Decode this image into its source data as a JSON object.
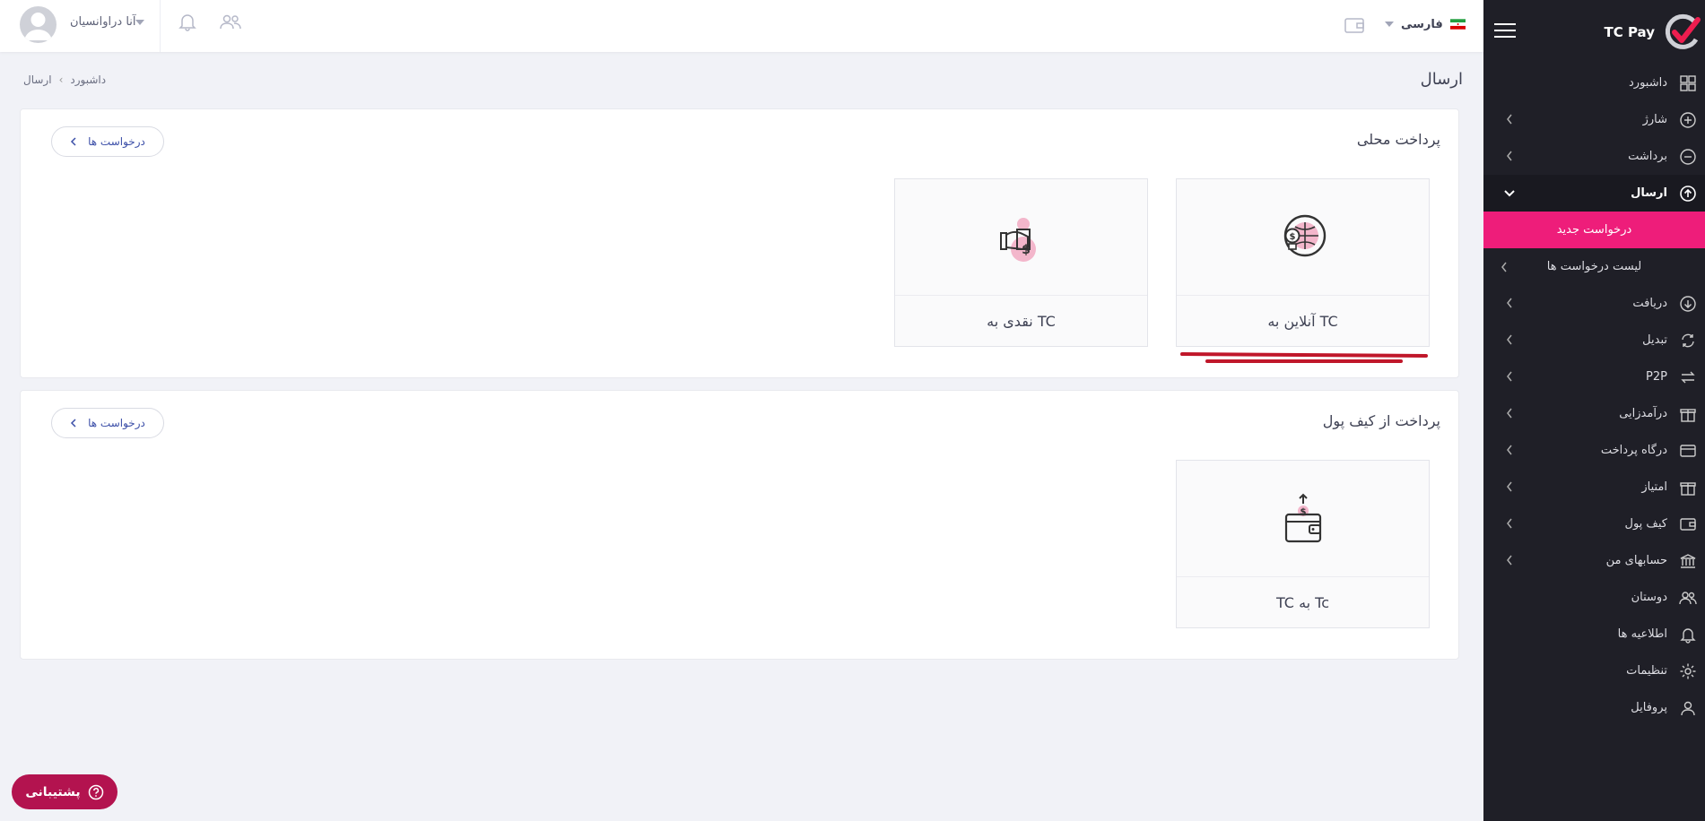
{
  "app": {
    "brand": "TC Pay"
  },
  "header": {
    "user_name": "آنا دراوانسیان",
    "language": "فارسی"
  },
  "page": {
    "title": "ارسال",
    "breadcrumb": [
      "داشبورد",
      "ارسال"
    ]
  },
  "sidebar": {
    "items": [
      {
        "label": "داشبورد",
        "icon": "dashboard-icon"
      },
      {
        "label": "شارژ",
        "icon": "plus-circle-icon"
      },
      {
        "label": "برداشت",
        "icon": "minus-circle-icon"
      },
      {
        "label": "ارسال",
        "icon": "upload-circle-icon"
      },
      {
        "label": "دریافت",
        "icon": "download-circle-icon"
      },
      {
        "label": "تبدیل",
        "icon": "exchange-icon"
      },
      {
        "label": "P2P",
        "icon": "transfer-icon"
      },
      {
        "label": "درآمدزایی",
        "icon": "gift-icon"
      },
      {
        "label": "درگاه پرداخت",
        "icon": "card-icon"
      },
      {
        "label": "امتیاز",
        "icon": "gift-icon"
      },
      {
        "label": "کیف پول",
        "icon": "wallet-icon"
      },
      {
        "label": "حسابهای من",
        "icon": "bank-icon"
      },
      {
        "label": "دوستان",
        "icon": "users-icon"
      },
      {
        "label": "اطلاعیه ها",
        "icon": "bell-icon"
      },
      {
        "label": "تنظیمات",
        "icon": "gear-icon"
      },
      {
        "label": "پروفایل",
        "icon": "user-icon"
      }
    ],
    "submenu": [
      {
        "label": "درخواست جدید"
      },
      {
        "label": "لیست درخواست ها"
      }
    ]
  },
  "sections": [
    {
      "title": "پرداخت محلی",
      "requests_label": "درخواست ها",
      "tiles": [
        {
          "label": "آنلاین به TC",
          "icon": "globe-dollar-icon"
        },
        {
          "label": "نقدی به TC",
          "icon": "cash-hand-icon"
        }
      ]
    },
    {
      "title": "پرداخت از کیف پول",
      "requests_label": "درخواست ها",
      "tiles": [
        {
          "label": "TC به Tc",
          "icon": "wallet-upload-icon"
        }
      ]
    }
  ],
  "support": {
    "label": "پشتیبانی"
  },
  "colors": {
    "sidebar_bg": "#1f1f27",
    "accent": "#ee1d7a",
    "support_bg": "#b3134f",
    "underline": "#c0172a"
  }
}
